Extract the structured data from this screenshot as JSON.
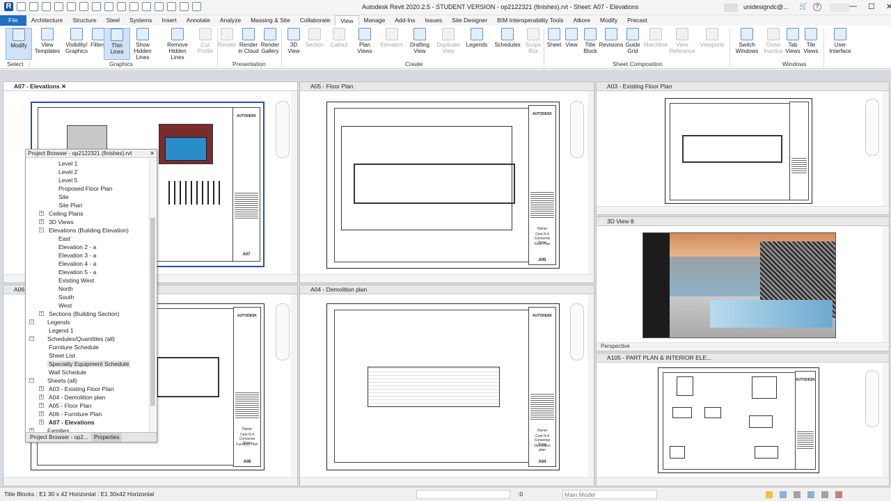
{
  "titlebar": {
    "title": "Autodesk Revit 2020.2.5 - STUDENT VERSION - op2122321 (finishes).rvt - Sheet: A07 - Elevations",
    "user": "unidesigndc@...",
    "min": "—",
    "max": "☐",
    "close": "✕"
  },
  "menu": [
    "File",
    "Architecture",
    "Structure",
    "Steel",
    "Systems",
    "Insert",
    "Annotate",
    "Analyze",
    "Massing & Site",
    "Collaborate",
    "View",
    "Manage",
    "Add-Ins",
    "Issues",
    "Site Designer",
    "BIM Interoperability Tools",
    "Atkore",
    "Modify",
    "Precast"
  ],
  "ribbon": {
    "buttons": [
      {
        "label": "Modify",
        "sub": ""
      },
      {
        "label": "View",
        "sub": "Templates"
      },
      {
        "label": "Visibility/",
        "sub": "Graphics"
      },
      {
        "label": "Filters",
        "sub": ""
      },
      {
        "label": "Thin",
        "sub": "Lines"
      },
      {
        "label": "Show",
        "sub": "Hidden Lines"
      },
      {
        "label": "Remove",
        "sub": "Hidden Lines"
      },
      {
        "label": "Cut",
        "sub": "Profile"
      },
      {
        "label": "Render",
        "sub": ""
      },
      {
        "label": "Render",
        "sub": "in Cloud"
      },
      {
        "label": "Render",
        "sub": "Gallery"
      },
      {
        "label": "3D",
        "sub": "View"
      },
      {
        "label": "Section",
        "sub": ""
      },
      {
        "label": "Callout",
        "sub": ""
      },
      {
        "label": "Plan",
        "sub": "Views"
      },
      {
        "label": "Elevation",
        "sub": ""
      },
      {
        "label": "Drafting",
        "sub": "View"
      },
      {
        "label": "Duplicate",
        "sub": "View"
      },
      {
        "label": "Legends",
        "sub": ""
      },
      {
        "label": "Schedules",
        "sub": ""
      },
      {
        "label": "Scope",
        "sub": "Box"
      },
      {
        "label": "Sheet",
        "sub": ""
      },
      {
        "label": "View",
        "sub": ""
      },
      {
        "label": "Title",
        "sub": "Block"
      },
      {
        "label": "Revisions",
        "sub": ""
      },
      {
        "label": "Guide",
        "sub": "Grid"
      },
      {
        "label": "Matchline",
        "sub": ""
      },
      {
        "label": "View",
        "sub": "Reference"
      },
      {
        "label": "Viewports",
        "sub": ""
      },
      {
        "label": "Switch",
        "sub": "Windows"
      },
      {
        "label": "Close",
        "sub": "Inactive"
      },
      {
        "label": "Tab",
        "sub": "Views"
      },
      {
        "label": "Tile",
        "sub": "Views"
      },
      {
        "label": "User",
        "sub": "Interface"
      }
    ],
    "groups": [
      "Select",
      "Graphics",
      "Presentation",
      "Create",
      "Sheet Composition",
      "Windows"
    ]
  },
  "panes": {
    "a07": "A07 - Elevations",
    "a05": "A05 - Floor Plan",
    "a03": "A03 - Existing Floor Plan",
    "view3d": "3D View 8",
    "a06": "A06",
    "a04": "A04 - Demolition plan",
    "a105": "A105 - PART PLAN & INTERIOR ELE...",
    "perspective": "Perspective"
  },
  "sheets": {
    "logo": "AUTODESK",
    "a07_num": "A07",
    "a05_num": "A05",
    "a05_name": "Floor Plan",
    "a06_num": "A06",
    "a06_name": "Furniture Plan",
    "a04_num": "A04",
    "a04_name": "Demolition plan",
    "owner": "Owner",
    "project": "Cent N 4 Convense Store"
  },
  "browser": {
    "title": "Project Browser - op2122321 (finishes).rvt",
    "items": [
      "Level 1",
      "Level 2",
      "Level 5",
      "Proposed Floor Plan",
      "Site",
      "Site Plan",
      "Ceiling Plans",
      "3D Views",
      "Elevations (Building Elevation)",
      "East",
      "Elevation 2 - a",
      "Elevation 3 - a",
      "Elevation 4 - a",
      "Elevation 5 - a",
      "Existing West",
      "North",
      "South",
      "West",
      "Sections (Building Section)",
      "Legends",
      "Legend 1",
      "Schedules/Quantities (all)",
      "Furniture Schedule",
      "Sheet List",
      "Specialty Equipment Schedule",
      "Wall Schedule",
      "Sheets (all)",
      "A03 - Existing Floor Plan",
      "A04 - Demolition plan",
      "A05 - Floor Plan",
      "A06 - Furniture Plan",
      "A07 - Elevations",
      "Families"
    ],
    "tab_browser": "Project Browser - op2...",
    "tab_properties": "Properties"
  },
  "status": {
    "left": "Title Blocks : E1 30 x 42 Horizontal : E1 30x42 Horizontal",
    "zero": ":0",
    "model": "Main Model"
  },
  "colors": {
    "file_tab": "#1f6fc2",
    "select_highlight": "#cfe2f7",
    "active_sheet_border": "#1f4fb0"
  }
}
